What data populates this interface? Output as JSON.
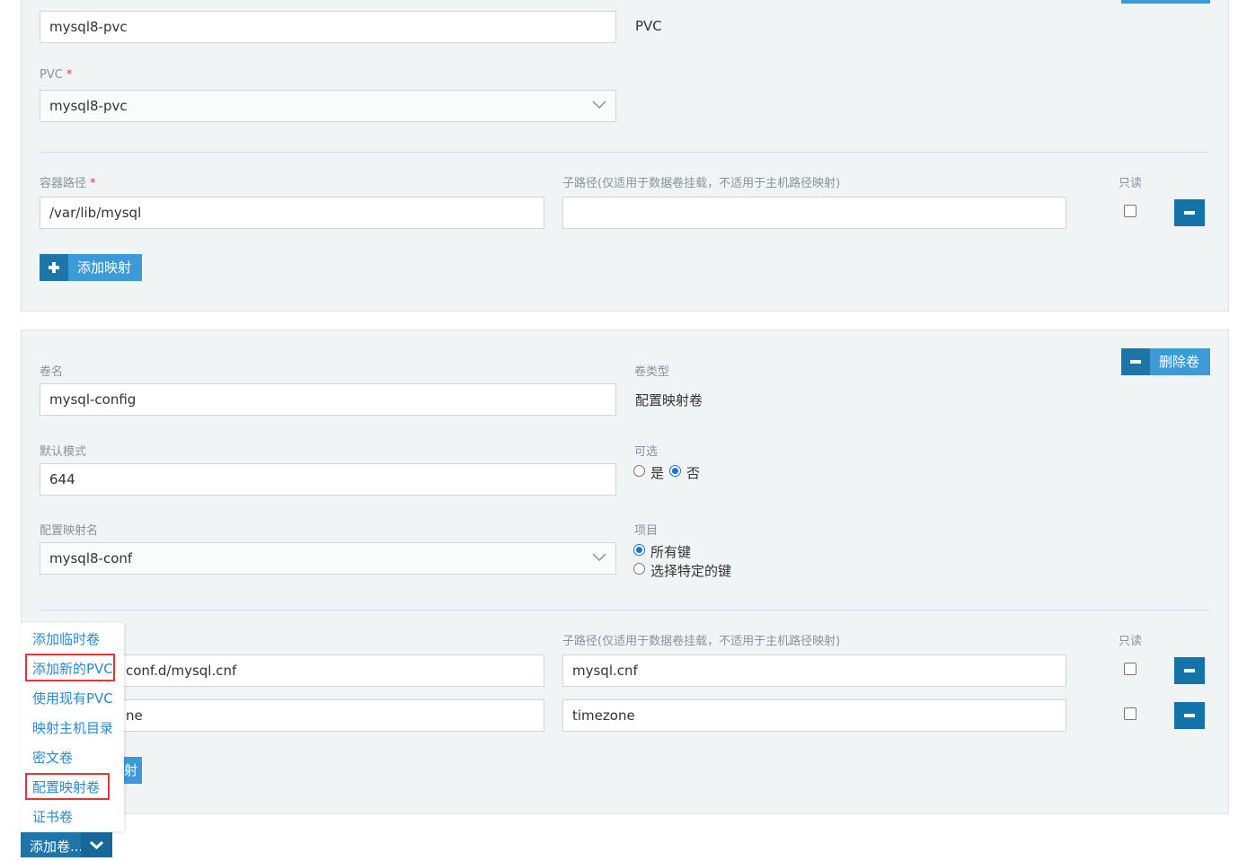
{
  "panel1": {
    "name_value": "mysql8-pvc",
    "type_value": "PVC",
    "pvc_label": "PVC",
    "pvc_selected": "mysql8-pvc",
    "container_path_label": "容器路径",
    "subpath_label": "子路径(仅适用于数据卷挂载，不适用于主机路径映射)",
    "readonly_label": "只读",
    "mount_path": "/var/lib/mysql",
    "mount_subpath": "",
    "add_mapping": "添加映射"
  },
  "panel2": {
    "name_label": "卷名",
    "name_value": "mysql-config",
    "type_label": "卷类型",
    "type_value": "配置映射卷",
    "delete_label": "删除卷",
    "default_mode_label": "默认模式",
    "default_mode_value": "644",
    "optional_label": "可选",
    "optional_yes": "是",
    "optional_no": "否",
    "configmap_label": "配置映射名",
    "configmap_selected": "mysql8-conf",
    "items_label": "项目",
    "items_all": "所有键",
    "items_specific": "选择特定的键",
    "subpath_label": "子路径(仅适用于数据卷挂载，不适用于主机路径映射)",
    "readonly_label": "只读",
    "rows": [
      {
        "path": "conf.d/mysql.cnf",
        "subpath": "mysql.cnf"
      },
      {
        "path": "ne",
        "subpath": "timezone"
      }
    ],
    "add_mapping_partial": "射"
  },
  "dropdown": {
    "items": [
      "添加临时卷",
      "添加新的PVC",
      "使用现有PVC",
      "映射主机目录",
      "密文卷",
      "配置映射卷",
      "证书卷"
    ]
  },
  "add_volume_button": "添加卷..."
}
